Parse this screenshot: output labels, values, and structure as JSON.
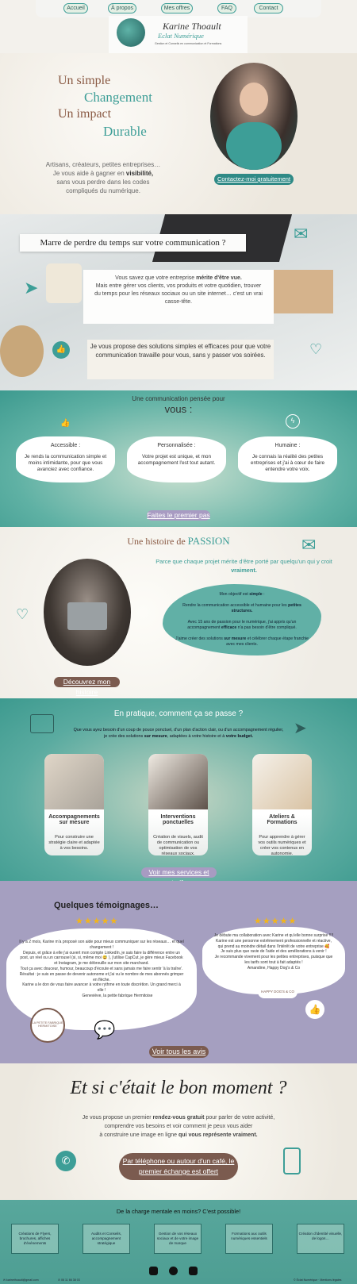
{
  "nav": {
    "items": [
      "Accueil",
      "À propos",
      "Mes offres",
      "FAQ",
      "Contact"
    ]
  },
  "logo": {
    "name": "Karine Thoault",
    "sub": "Eclat Numérique",
    "tagline": "Gestion et Conseils en communication et Formations"
  },
  "hero": {
    "line1": "Un simple",
    "line2": "Changement",
    "line3": "Un impact",
    "line4": "Durable",
    "desc1": "Artisans, créateurs, petites entreprises…",
    "desc2": "Je vous aide à gagner en",
    "desc2_bold": "visibilité,",
    "desc3": "sans vous perdre dans les codes compliqués du numérique.",
    "cta": "Contactez-moi gratuitement"
  },
  "desk": {
    "title": "Marre de perdre du temps sur votre communication ?",
    "box1_a": "Vous savez que votre entreprise",
    "box1_b": "mérite d'être vue.",
    "box1_c": "Mais entre gérer vos clients, vos produits et votre quotidien, trouver du temps pour les réseaux sociaux ou un site internet… c'est un vrai casse-tête.",
    "box2": "Je vous propose des solutions simples et efficaces pour que votre communication travaille pour vous, sans y passer vos soirées."
  },
  "qual": {
    "intro": "Une communication pensée pour",
    "title": "vous :",
    "cards": [
      {
        "title": "Accessible :",
        "text": "Je rends la communication simple et moins intimidante, pour que vous avanciez avec confiance."
      },
      {
        "title": "Personnalisée :",
        "text": "Votre projet est unique, et mon accompagnement l'est tout autant."
      },
      {
        "title": "Humaine :",
        "text": "Je connais la réalité des petites entreprises et j'ai à cœur de faire entendre votre voix."
      }
    ],
    "cta": "Faites le premier pas"
  },
  "hist": {
    "title_a": "Une histoire de",
    "title_b": "PASSION",
    "sub_a": "Parce que chaque projet mérite d'être porté par quelqu'un qui y croit",
    "sub_b": "vraiment.",
    "p1_a": "Mon objectif est",
    "p1_b": "simple",
    "p2_a": "Rendre la communication accessible et humaine pour les",
    "p2_b": "petites structures.",
    "p3_a": "Avec 15 ans de passion pour le numérique, j'ai appris qu'un accompagnement",
    "p3_b": "efficace",
    "p3_c": "n'a pas besoin d'être compliqué.",
    "p4_a": "J'aime créer des solutions",
    "p4_b": "sur mesure",
    "p4_c": "et célébrer chaque étape franchie avec mes clients.",
    "cta": "Découvrez mon histoire"
  },
  "prat": {
    "title": "En pratique, comment ça se passe ?",
    "intro_a": "Que vous ayez besoin d'un coup de pouce ponctuel, d'un plan d'action clair, ou d'un accompagnement régulier, je crée des solutions",
    "intro_b": "sur mesure",
    "intro_c": ", adaptées à votre histoire et à",
    "intro_d": "votre budget.",
    "cards": [
      {
        "title": "Accompagnements sur mesure",
        "text": "Pour construire une stratégie claire et adaptée à vos besoins."
      },
      {
        "title": "Interventions ponctuelles",
        "text": "Création de visuels, audit de communication ou optimisation de vos réseaux sociaux."
      },
      {
        "title": "Ateliers & Formations",
        "text": "Pour apprendre à gérer vos outils numériques et créer vos contenus en autonomie."
      }
    ],
    "cta": "Voir mes services et tarifs"
  },
  "temo": {
    "title": "Quelques témoignages…",
    "t1": [
      "Il y a 2 mois, Karine m'a proposé son aide pour mieux communiquer sur les réseaux… et quel changement !",
      "Depuis, et grâce à elle j'ai ouvert mon compte LinkedIn, je sais faire la différence entre un post, un réel ou un carrousel (si, si, même moi 😅 ), j'utilise CapCut, je gère mieux Facebook et Instagram, je me débrouille sur mon site marchand.",
      "Tout ça avec douceur, humour, beaucoup d'écoute et sans jamais me faire sentir 'à la traîne'.",
      "Résultat : je suis en passe de devenir autonome et j'ai vu le nombre de mes abonnés grimper en flèche.",
      "Karine a le don de vous faire avancer à votre rythme en toute discrétion. Un grand merci à elle !",
      "Geneviève, la petite fabrique Hermitoise"
    ],
    "t2": [
      "Je débute ma collaboration avec Karine et qu'elle bonne surprise !!!!",
      "Karine est une personne extrêmement professionnelle et réactive, qui prend au moindre détail dans l'intérêt de votre entreprise 🥰",
      "Je suis plus que ravie de l'aide et des améliorations à venir !",
      "Je recommande vivement pour les petites entreprises, puisque que les tarifs sont tout à fait adaptés !",
      "Amandine, Happy Dog's & Co"
    ],
    "stars": "★★★★★",
    "badge": "LA PETITE FABRIQUE HERMITOISE",
    "logo2": "HAPPY DOG'S & CO",
    "cta": "Voir tous les avis"
  },
  "rdv": {
    "title": "Et si c'était le bon moment ?",
    "l1_a": "Je vous propose un premier",
    "l1_b": "rendez-vous gratuit",
    "l1_c": "pour parler de votre activité,",
    "l2": "comprendre vos besoins et voir comment je peux vous aider",
    "l3_a": "à construire une image en ligne",
    "l3_b": "qui vous représente vraiment.",
    "cta": "Par téléphone ou autour d'un café, le premier échange est offert"
  },
  "foot": {
    "title": "De la charge mentale en moins? C'est possible!",
    "cards": [
      "Créations de Flyers, brochures, affiches d'événements",
      "Audits et Conseils, accompagnement stratégique",
      "Gestion de vos réseaux sociaux et de votre image de marque",
      "Formations aux outils numériques essentiels",
      "Création d'identité visuelle, de logos…"
    ],
    "email": "karinethoault@gmail.com",
    "phone": "06 11 66 38 03",
    "legal1": "© Éclat Numérique",
    "legal2": "Mentions légales"
  },
  "colors": {
    "teal": "#3d9e97",
    "brown": "#7b5b4f",
    "lavender": "#a59fc0"
  }
}
